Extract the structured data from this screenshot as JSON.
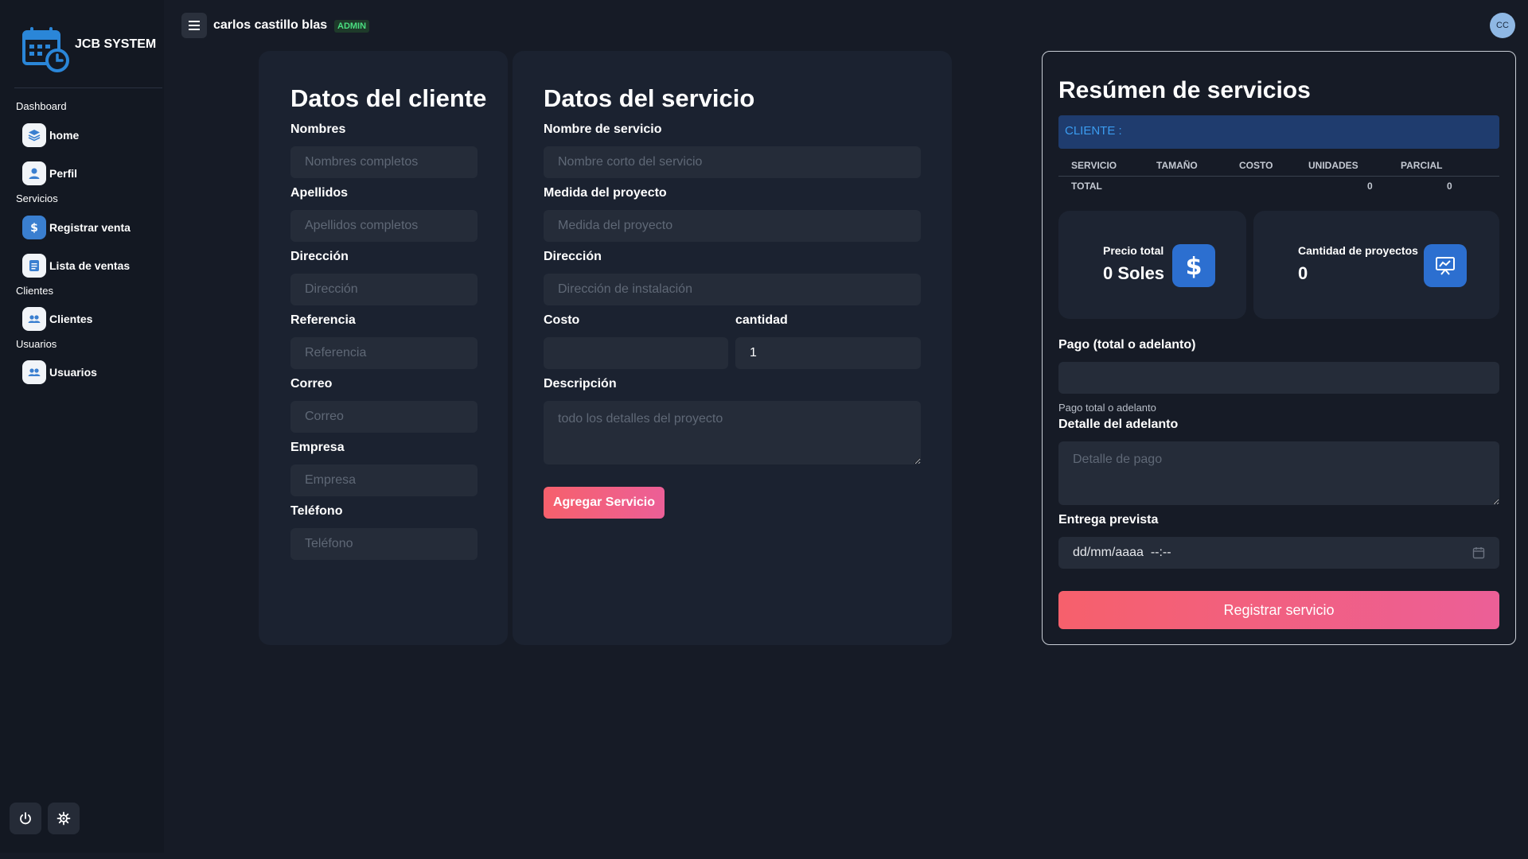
{
  "app": {
    "name": "JCB SYSTEM"
  },
  "user": {
    "name": "carlos castillo blas",
    "role": "ADMIN",
    "initials": "CC"
  },
  "sidebar": {
    "sections": [
      {
        "label": "Dashboard"
      },
      {
        "label": "Servicios"
      },
      {
        "label": "Clientes"
      },
      {
        "label": "Usuarios"
      }
    ],
    "items": [
      {
        "label": "home",
        "icon": "layers-icon"
      },
      {
        "label": "Perfil",
        "icon": "user-icon"
      },
      {
        "label": "Registrar venta",
        "icon": "dollar-icon"
      },
      {
        "label": "Lista de ventas",
        "icon": "list-icon"
      },
      {
        "label": "Clientes",
        "icon": "users-icon"
      },
      {
        "label": "Usuarios",
        "icon": "users-icon"
      }
    ]
  },
  "cliente": {
    "title": "Datos del cliente",
    "fields": [
      {
        "label": "Nombres",
        "placeholder": "Nombres completos"
      },
      {
        "label": "Apellidos",
        "placeholder": "Apellidos completos"
      },
      {
        "label": "Dirección",
        "placeholder": "Dirección"
      },
      {
        "label": "Referencia",
        "placeholder": "Referencia"
      },
      {
        "label": "Correo",
        "placeholder": "Correo"
      },
      {
        "label": "Empresa",
        "placeholder": "Empresa"
      },
      {
        "label": "Teléfono",
        "placeholder": "Teléfono"
      }
    ]
  },
  "servicio": {
    "title": "Datos del servicio",
    "nombre": {
      "label": "Nombre de servicio",
      "placeholder": "Nombre corto del servicio"
    },
    "medida": {
      "label": "Medida del proyecto",
      "placeholder": "Medida del proyecto"
    },
    "direccion": {
      "label": "Dirección",
      "placeholder": "Dirección de instalación"
    },
    "costo": {
      "label": "Costo",
      "value": ""
    },
    "cantidad": {
      "label": "cantidad",
      "value": "1"
    },
    "descripcion": {
      "label": "Descripción",
      "placeholder": "todo los detalles del proyecto"
    },
    "add_button": "Agregar Servicio"
  },
  "resumen": {
    "title": "Resúmen de servicios",
    "cliente_label": "CLIENTE :",
    "table": {
      "headers": [
        "SERVICIO",
        "TAMAÑO",
        "COSTO",
        "UNIDADES",
        "PARCIAL"
      ],
      "total_label": "TOTAL",
      "total_unidades": "0",
      "total_parcial": "0"
    },
    "precio_total": {
      "label": "Precio total",
      "value": "0 Soles"
    },
    "cantidad_proyectos": {
      "label": "Cantidad de proyectos",
      "value": "0"
    },
    "pago": {
      "label": "Pago (total o adelanto)",
      "hint": "Pago total o adelanto",
      "value": ""
    },
    "detalle": {
      "label": "Detalle del adelanto",
      "placeholder": "Detalle de pago"
    },
    "entrega": {
      "label": "Entrega prevista",
      "value": "dd/mm/aaaa  --:--"
    },
    "submit_button": "Registrar servicio"
  },
  "colors": {
    "background": "#161b26",
    "card": "#1b2230",
    "input": "#252c39",
    "accent_blue": "#3a7fd0",
    "gradient_start": "#f6606c",
    "gradient_end": "#ec5f97",
    "badge_green": "#4ade80"
  }
}
